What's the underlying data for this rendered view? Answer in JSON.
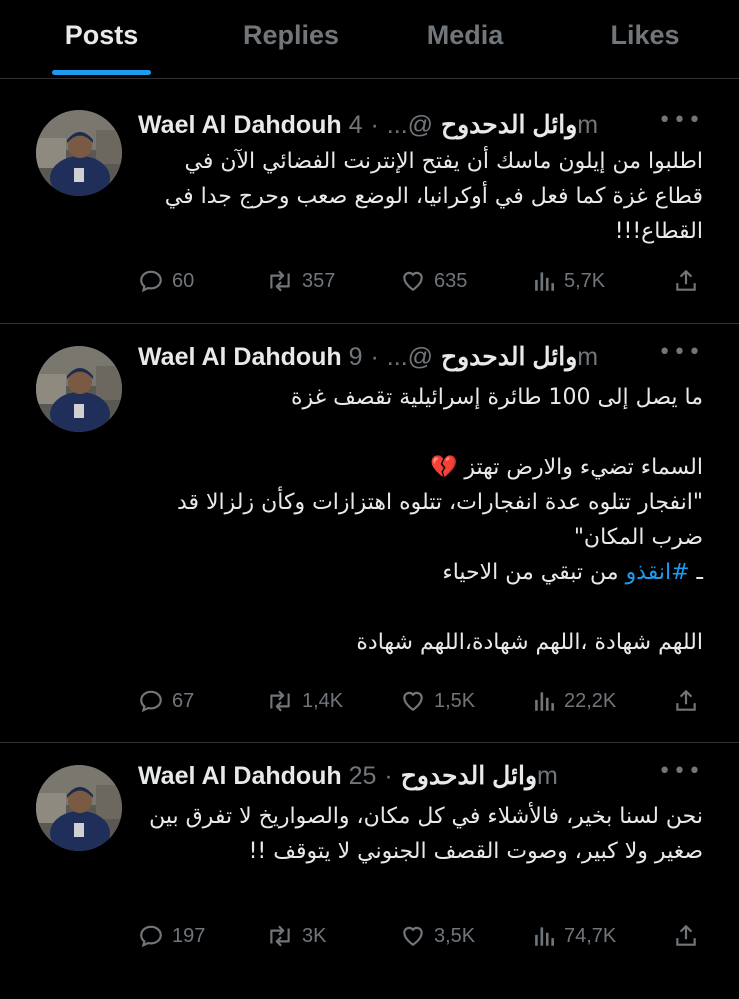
{
  "tabs": [
    {
      "label": "Posts",
      "active": true
    },
    {
      "label": "Replies",
      "active": false
    },
    {
      "label": "Media",
      "active": false
    },
    {
      "label": "Likes",
      "active": false
    }
  ],
  "author": {
    "name": "Wael Al Dahdouh وائل الدحدوح",
    "handle": "@..."
  },
  "tweets": [
    {
      "time": "4m",
      "text": "اطلبوا من إيلون ماسك أن يفتح الإنترنت الفضائي الآن في قطاع غزة كما فعل في أوكرانيا، الوضع صعب وحرج جدا في القطاع!!!",
      "replies": "60",
      "retweets": "357",
      "likes": "635",
      "views": "5,7K"
    },
    {
      "time": "9m",
      "line1": "ما يصل إلى 100 طائرة إسرائيلية تقصف غزة",
      "line2": "السماء تضيء والارض تهتز 💔",
      "line3": "\"انفجار تتلوه عدة انفجارات، تتلوه اهتزازات وكأن زلزالا قد ضرب المكان\"",
      "hashtag": "#انقذو",
      "line4_rest": " من تبقي من الاحياء",
      "line5": "اللهم شهادة ،اللهم شهادة،اللهم شهادة",
      "replies": "67",
      "retweets": "1,4K",
      "likes": "1,5K",
      "views": "22,2K"
    },
    {
      "time": "25m",
      "text": "نحن لسنا بخير، فالأشلاء في كل مكان، والصواريخ لا تفرق بين صغير ولا كبير، وصوت القصف الجنوني لا يتوقف !!",
      "replies": "197",
      "retweets": "3K",
      "likes": "3,5K",
      "views": "74,7K"
    }
  ],
  "colors": {
    "accent": "#1d9bf0",
    "muted": "#71767b",
    "text": "#e7e9ea",
    "divider": "#2f3336"
  },
  "icons": [
    "reply-icon",
    "retweet-icon",
    "like-icon",
    "views-icon",
    "share-icon",
    "more-icon"
  ]
}
